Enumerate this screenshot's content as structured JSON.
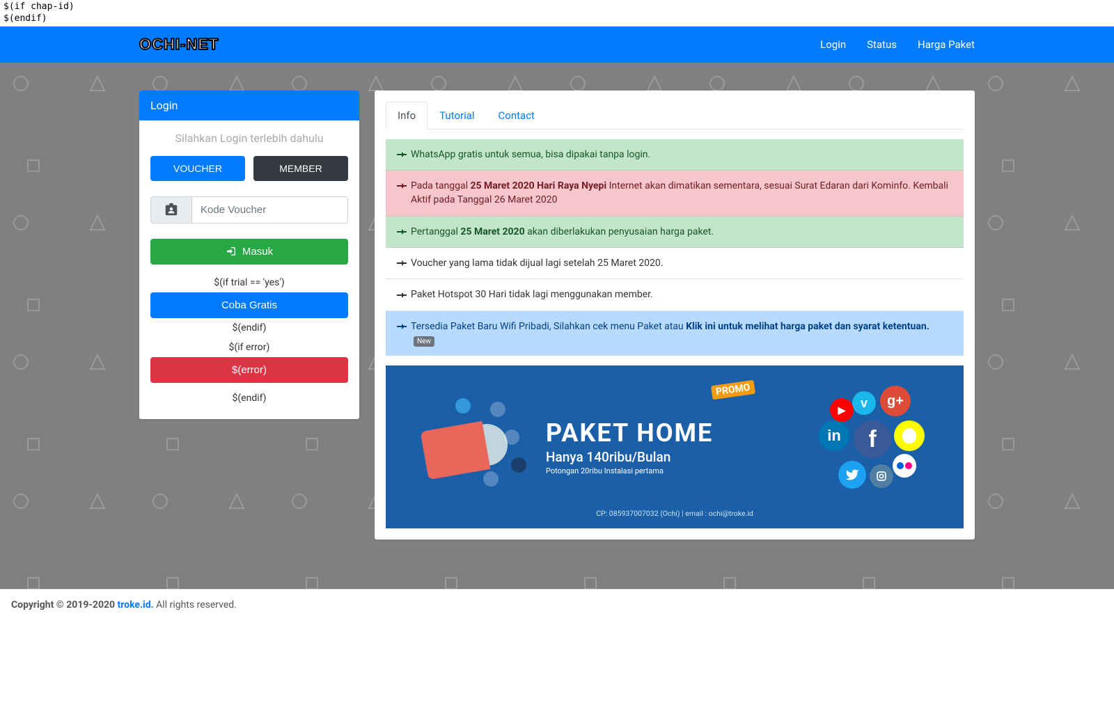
{
  "top_placeholder": {
    "line1": "$(if chap-id)",
    "line2": "$(endif)"
  },
  "header": {
    "logo": "OCHI-NET",
    "nav": {
      "login": "Login",
      "status": "Status",
      "harga": "Harga Paket"
    }
  },
  "login": {
    "header": "Login",
    "prompt": "Silahkan Login terlebih dahulu",
    "voucher_btn": "VOUCHER",
    "member_btn": "MEMBER",
    "voucher_placeholder": "Kode Voucher",
    "masuk_btn": "Masuk",
    "trial_cond": "$(if trial == 'yes')",
    "coba_btn": "Coba Gratis",
    "endif1": "$(endif)",
    "error_cond": "$(if error)",
    "error_btn": "$(error)",
    "endif2": "$(endif)"
  },
  "tabs": {
    "info": "Info",
    "tutorial": "Tutorial",
    "contact": "Contact"
  },
  "info_items": [
    {
      "style": "green",
      "html": "WhatsApp gratis untuk semua, bisa dipakai tanpa login."
    },
    {
      "style": "red",
      "html": "Pada tanggal <b>25 Maret 2020 Hari Raya Nyepi</b> Internet akan dimatikan sementara, sesuai Surat Edaran dari Kominfo. Kembali Aktif pada Tanggal 26 Maret 2020"
    },
    {
      "style": "green",
      "html": "Pertanggal <b>25 Maret 2020</b> akan diberlakukan penyusaian harga paket."
    },
    {
      "style": "white",
      "html": "Voucher yang lama tidak dijual lagi setelah 25 Maret 2020."
    },
    {
      "style": "white",
      "html": "Paket Hotspot 30 Hari tidak lagi menggunakan member."
    },
    {
      "style": "blue",
      "html": "Tersedia Paket Baru Wifi Pribadi, Silahkan cek menu Paket atau <b>Klik ini untuk melihat harga paket dan syarat ketentuan.</b> <span class='new-badge'>New</span>"
    }
  ],
  "banner": {
    "promo": "PROMO",
    "title": "PAKET HOME",
    "sub": "Hanya 140ribu/Bulan",
    "sub2": "Potongan 20ribu Instalasi pertama",
    "footer": "CP: 085937007032 (Ochi) | email : ochi@troke.id"
  },
  "footer": {
    "copyright_pre": "Copyright © 2019-2020 ",
    "link": "troke.id.",
    "copyright_post": " All rights reserved."
  }
}
